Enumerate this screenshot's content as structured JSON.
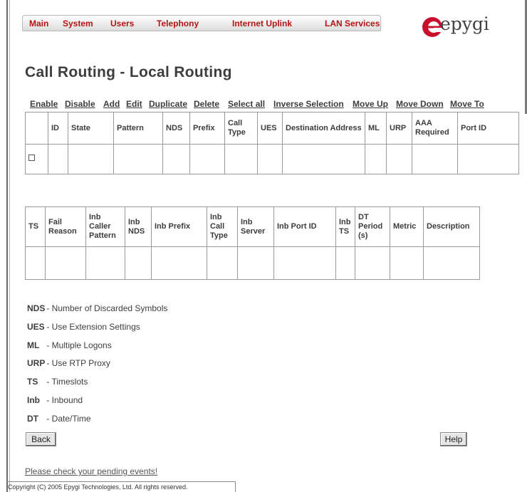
{
  "menu": {
    "items": [
      "Main",
      "System",
      "Users",
      "Telephony",
      "Internet Uplink",
      "LAN Services"
    ]
  },
  "logo": {
    "text": "epygi",
    "color": "#c8102e"
  },
  "page": {
    "title": "Call Routing - Local Routing"
  },
  "toolbar": {
    "actions": [
      "Enable",
      "Disable",
      "Add",
      "Edit",
      "Duplicate",
      "Delete",
      "Select all",
      "Inverse Selection",
      "Move Up",
      "Move Down",
      "Move To"
    ]
  },
  "table1": {
    "headers": [
      "",
      "ID",
      "State",
      "Pattern",
      "NDS",
      "Prefix",
      "Call Type",
      "UES",
      "Destination Address",
      "ML",
      "URP",
      "AAA Required",
      "Port ID"
    ]
  },
  "table2": {
    "headers": [
      "TS",
      "Fail Reason",
      "Inb Caller Pattern",
      "Inb NDS",
      "Inb Prefix",
      "Inb Call Type",
      "Inb Server",
      "Inb Port ID",
      "Inb TS",
      "DT Period (s)",
      "Metric",
      "Description"
    ]
  },
  "legend": [
    {
      "abbr": "NDS",
      "text": "- Number of Discarded Symbols"
    },
    {
      "abbr": "UES",
      "text": "- Use Extension Settings"
    },
    {
      "abbr": "ML",
      "text": "- Multiple Logons"
    },
    {
      "abbr": "URP",
      "text": "- Use RTP Proxy"
    },
    {
      "abbr": "TS",
      "text": "- Timeslots"
    },
    {
      "abbr": "Inb",
      "text": "- Inbound"
    },
    {
      "abbr": "DT",
      "text": "- Date/Time"
    }
  ],
  "buttons": {
    "back": "Back",
    "help": "Help"
  },
  "pending_link": "Please check your pending events!",
  "footer": "Copyright (C) 2005 Epygi Technologies, Ltd. All rights reserved.",
  "colors": {
    "menu_text": "#b31313",
    "text": "#3d3d3d",
    "border": "#9a9a9a"
  }
}
